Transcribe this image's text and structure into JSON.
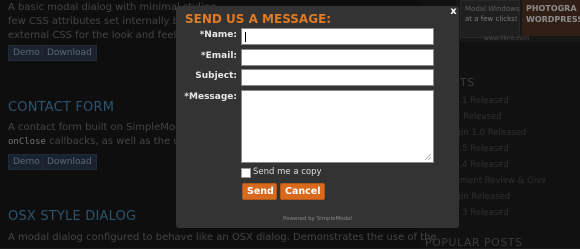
{
  "background": {
    "intro_lines": [
      "A basic modal dialog with minimal styling",
      "few CSS attributes set internally by Sim",
      "external CSS for the look and feel."
    ],
    "demo_label": "Demo",
    "download_label": "Download",
    "contact_heading": "CONTACT FORM",
    "contact_line1": "A contact form built on SimpleModal. D",
    "contact_code": "onClose",
    "contact_line2_rest": " callbacks, as well as the use of",
    "osx_heading": "OSX STYLE DIALOG",
    "osx_line1": "A modal dialog configured to behave like an OSX dialog. Demonstrates the use of the",
    "sidebar": {
      "recent_heading": "T POSTS",
      "links": [
        "odal 1.4.1 Released",
        "nate 1.2 Released",
        "odal Login 1.0 Released",
        "odal 1.3.5 Released",
        "odal 1.3.4 Released",
        "nlightenment Review & Give",
        "odal Login Released",
        "odal 1.3.3 Released"
      ],
      "popular_heading": "POPULAR POSTS"
    },
    "ad": {
      "left_text": "Modal Windows",
      "left_sub": "at a few clicks!",
      "right_line1": "PHOTOGRA",
      "right_line2": "WORDPRESS",
      "url": "www.likno.com"
    }
  },
  "modal": {
    "title": "SEND US A MESSAGE:",
    "close_glyph": "x",
    "fields": {
      "name_label": "*Name:",
      "email_label": "*Email:",
      "subject_label": "Subject:",
      "message_label": "*Message:",
      "name_value": "",
      "email_value": "",
      "subject_value": "",
      "message_value": ""
    },
    "send_copy_label": "Send me a copy",
    "send_copy_checked": false,
    "send_label": "Send",
    "cancel_label": "Cancel",
    "powered_by": "Powered by SimpleModal"
  },
  "colors": {
    "modal_bg": "#333333",
    "accent_orange": "#e07a23",
    "button_orange": "#d86a1e",
    "link_blue": "#4f97c6"
  }
}
